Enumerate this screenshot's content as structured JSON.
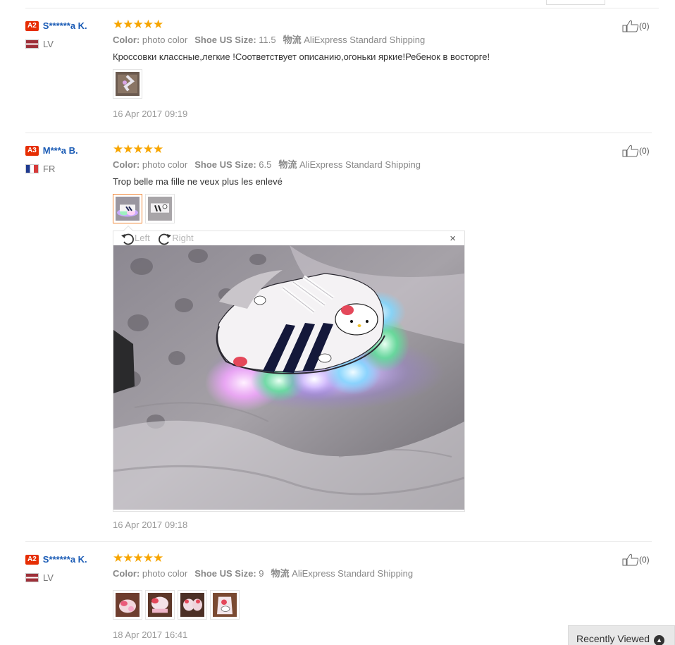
{
  "labels": {
    "color": "Color:",
    "size": "Shoe US Size:",
    "logistics": "物流"
  },
  "reviews": [
    {
      "level": "A2",
      "name": "S******a K.",
      "country": "LV",
      "stars": "★★★★★",
      "color": "photo color",
      "size": "11.5",
      "shipping": "AliExpress Standard Shipping",
      "text": "Кроссовки классные,легкие !Соответствует описанию,огоньки яркие!Ребенок в восторге!",
      "date": "16 Apr 2017 09:19",
      "likes": "(0)"
    },
    {
      "level": "A3",
      "name": "M***a B.",
      "country": "FR",
      "stars": "★★★★★",
      "color": "photo color",
      "size": "6.5",
      "shipping": "AliExpress Standard Shipping",
      "text": "Trop belle ma fille ne veux plus les enlevé",
      "date": "16 Apr 2017 09:18",
      "likes": "(0)"
    },
    {
      "level": "A2",
      "name": "S******a K.",
      "country": "LV",
      "stars": "★★★★★",
      "color": "photo color",
      "size": "9",
      "shipping": "AliExpress Standard Shipping",
      "text": "",
      "date": "18 Apr 2017 16:41",
      "likes": "(0)"
    }
  ],
  "viewer": {
    "rotate_left": "Left",
    "rotate_right": "Right",
    "close": "×"
  },
  "recently_viewed": "Recently Viewed",
  "icons": {
    "like": "thumbs-up-icon",
    "rotate_left": "rotate-left-icon",
    "rotate_right": "rotate-right-icon",
    "close": "close-icon",
    "up": "chevron-up-icon"
  },
  "colors": {
    "badge": "#e62e04",
    "username": "#1a5bb5",
    "stars": "#f7a500",
    "active_thumb": "#f08a3d"
  }
}
